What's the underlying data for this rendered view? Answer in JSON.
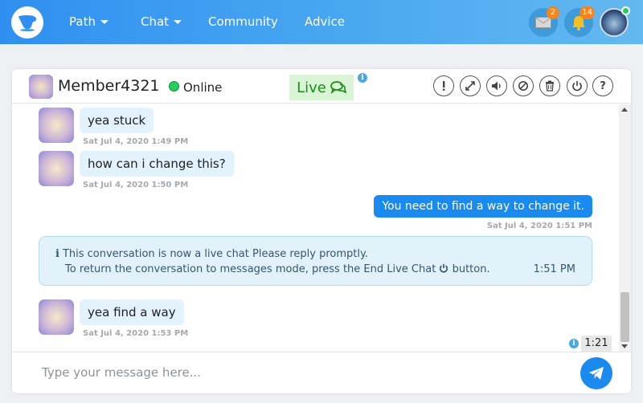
{
  "nav": {
    "items": [
      {
        "label": "Path",
        "caret": true
      },
      {
        "label": "Chat",
        "caret": true
      },
      {
        "label": "Community",
        "caret": false
      },
      {
        "label": "Advice",
        "caret": false
      }
    ],
    "mail_badge": "2",
    "notifications_badge": "14"
  },
  "chat_header": {
    "member_name": "Member4321",
    "status": "Online",
    "live_label": "Live",
    "buttons": [
      "report-icon",
      "expand-icon",
      "sound-icon",
      "block-icon",
      "trash-icon",
      "power-icon",
      "help-icon"
    ]
  },
  "messages": [
    {
      "from": "member",
      "text": "yea stuck",
      "time": "Sat Jul 4, 2020 1:49 PM"
    },
    {
      "from": "member",
      "text": "how can i change this?",
      "time": "Sat Jul 4, 2020 1:50 PM"
    },
    {
      "from": "me",
      "text": "You need to find a way to change it.",
      "time": "Sat Jul 4, 2020 1:51 PM"
    },
    {
      "from": "member",
      "text": "yea find a way",
      "time": "Sat Jul 4, 2020 1:53 PM"
    }
  ],
  "notice": {
    "line1": "This conversation is now a live chat Please reply promptly.",
    "line2_before": "To return the conversation to messages mode, press the End Live Chat",
    "line2_after": "button.",
    "time": "1:51 PM"
  },
  "timer": "1:21",
  "input": {
    "placeholder": "Type your message here..."
  },
  "colors": {
    "nav_start": "#2f8ff0",
    "nav_end": "#63b8ef",
    "accent": "#1a8aee",
    "live_bg": "#d9f5d5",
    "online": "#22d05a",
    "badge": "#f5841f"
  }
}
